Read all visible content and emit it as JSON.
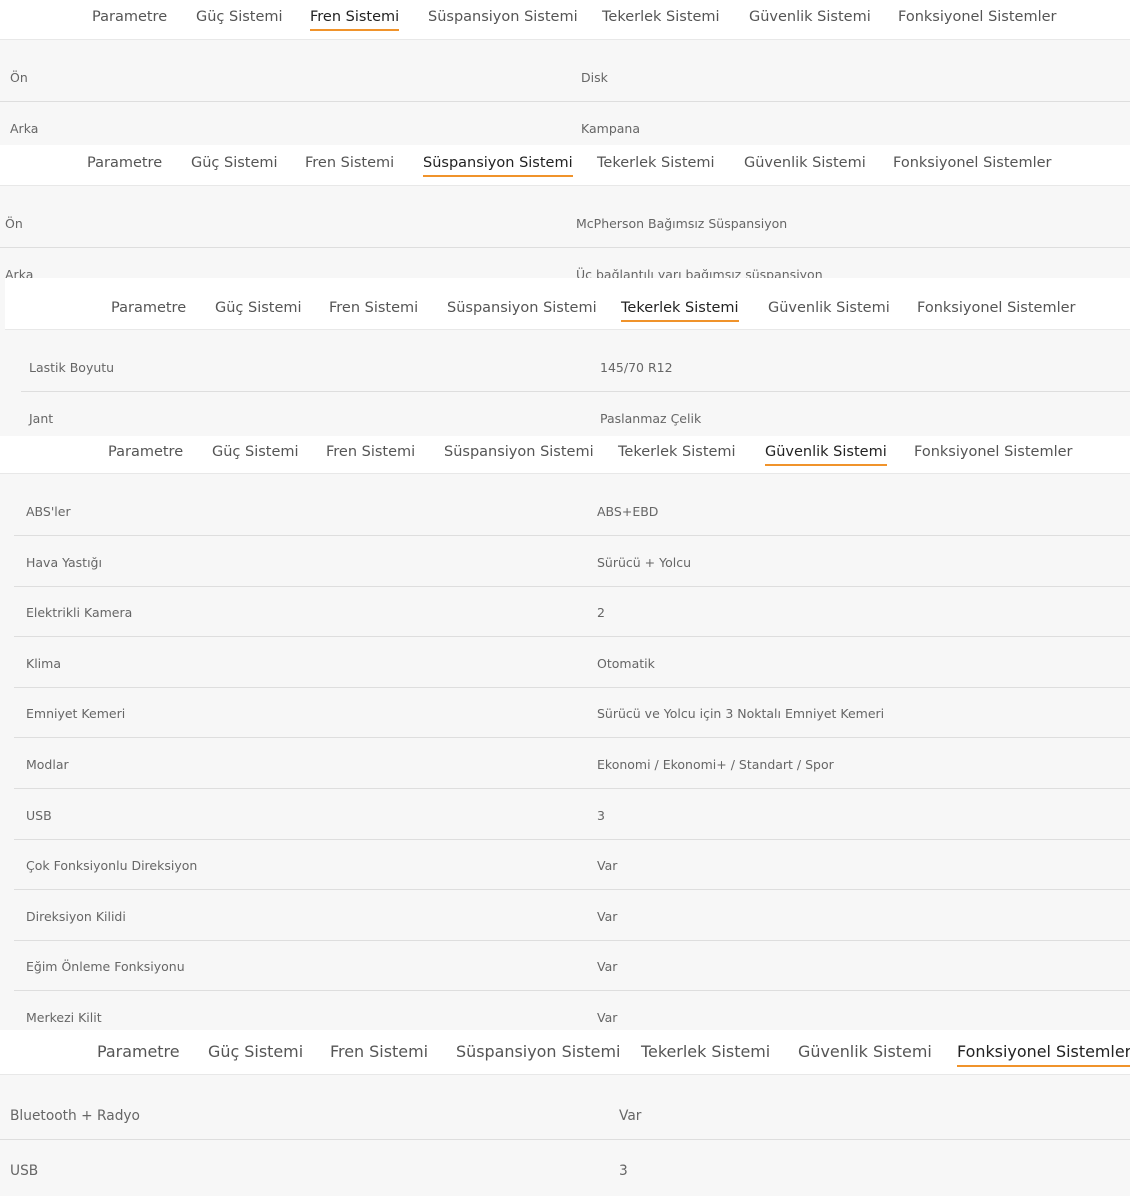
{
  "tabs": [
    "Parametre",
    "Güç Sistemi",
    "Fren Sistemi",
    "Süspansiyon Sistemi",
    "Tekerlek Sistemi",
    "Güvenlik Sistemi",
    "Fonksiyonel Sistemler"
  ],
  "brand_color": "#f0932b",
  "panels": [
    {
      "active_tab": "Fren Sistemi",
      "rows": [
        {
          "label": "Ön",
          "value": "Disk"
        },
        {
          "label": "Arka",
          "value": "Kampana"
        }
      ]
    },
    {
      "active_tab": "Süspansiyon Sistemi",
      "rows": [
        {
          "label": "Ön",
          "value": "McPherson Bağımsız Süspansiyon"
        },
        {
          "label": "Arka",
          "value": "Üç bağlantılı yarı bağımsız süspansiyon"
        }
      ]
    },
    {
      "active_tab": "Tekerlek Sistemi",
      "rows": [
        {
          "label": "Lastik Boyutu",
          "value": "145/70 R12"
        },
        {
          "label": "Jant",
          "value": "Paslanmaz Çelik"
        }
      ]
    },
    {
      "active_tab": "Güvenlik Sistemi",
      "rows": [
        {
          "label": "ABS'ler",
          "value": "ABS+EBD"
        },
        {
          "label": "Hava Yastığı",
          "value": "Sürücü + Yolcu"
        },
        {
          "label": "Elektrikli Kamera",
          "value": "2"
        },
        {
          "label": "Klima",
          "value": "Otomatik"
        },
        {
          "label": "Emniyet Kemeri",
          "value": "Sürücü ve Yolcu için 3 Noktalı Emniyet Kemeri"
        },
        {
          "label": "Modlar",
          "value": "Ekonomi / Ekonomi+ / Standart / Spor"
        },
        {
          "label": "USB",
          "value": "3"
        },
        {
          "label": "Çok Fonksiyonlu Direksiyon",
          "value": "Var"
        },
        {
          "label": "Direksiyon Kilidi",
          "value": "Var"
        },
        {
          "label": "Eğim Önleme Fonksiyonu",
          "value": "Var"
        },
        {
          "label": "Merkezi Kilit",
          "value": "Var"
        }
      ]
    },
    {
      "active_tab": "Fonksiyonel Sistemler",
      "rows": [
        {
          "label": "Bluetooth + Radyo",
          "value": "Var"
        },
        {
          "label": "USB",
          "value": "3"
        }
      ]
    }
  ]
}
